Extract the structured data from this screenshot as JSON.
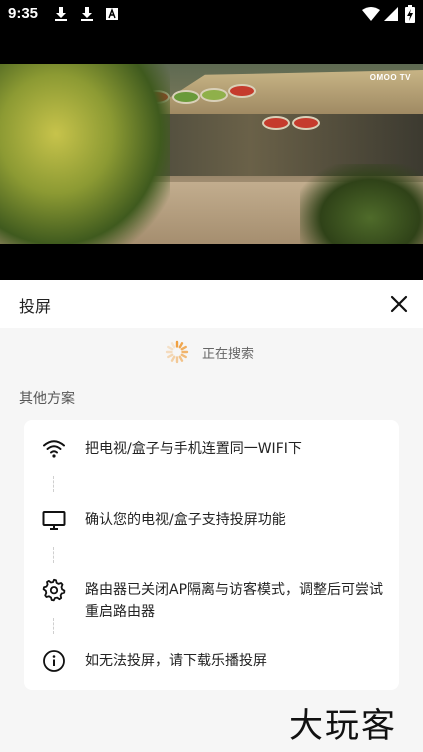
{
  "status_bar": {
    "time": "9:35",
    "left_icons": [
      "download-icon",
      "download-icon",
      "text-a-icon"
    ],
    "right_icons": [
      "wifi-icon",
      "signal-icon",
      "battery-charging-icon"
    ]
  },
  "video": {
    "logo_text": "OMOO TV"
  },
  "sheet": {
    "title": "投屏",
    "close_icon": "close-icon",
    "searching_text": "正在搜索",
    "other_solutions_label": "其他方案",
    "steps": [
      {
        "icon": "wifi-icon",
        "text": "把电视/盒子与手机连置同一WIFI下"
      },
      {
        "icon": "tv-monitor-icon",
        "text": "确认您的电视/盒子支持投屏功能"
      },
      {
        "icon": "gear-icon",
        "text": "路由器已关闭AP隔离与访客模式，调整后可尝试重启路由器"
      },
      {
        "icon": "info-icon",
        "text": "如无法投屏，请下载乐播投屏"
      }
    ]
  },
  "watermark": "大玩客",
  "colors": {
    "sheet_background": "#f6f6f6",
    "card_background": "#ffffff",
    "spinner": "#f0a040",
    "text_primary": "#222222",
    "text_secondary": "#666666"
  }
}
